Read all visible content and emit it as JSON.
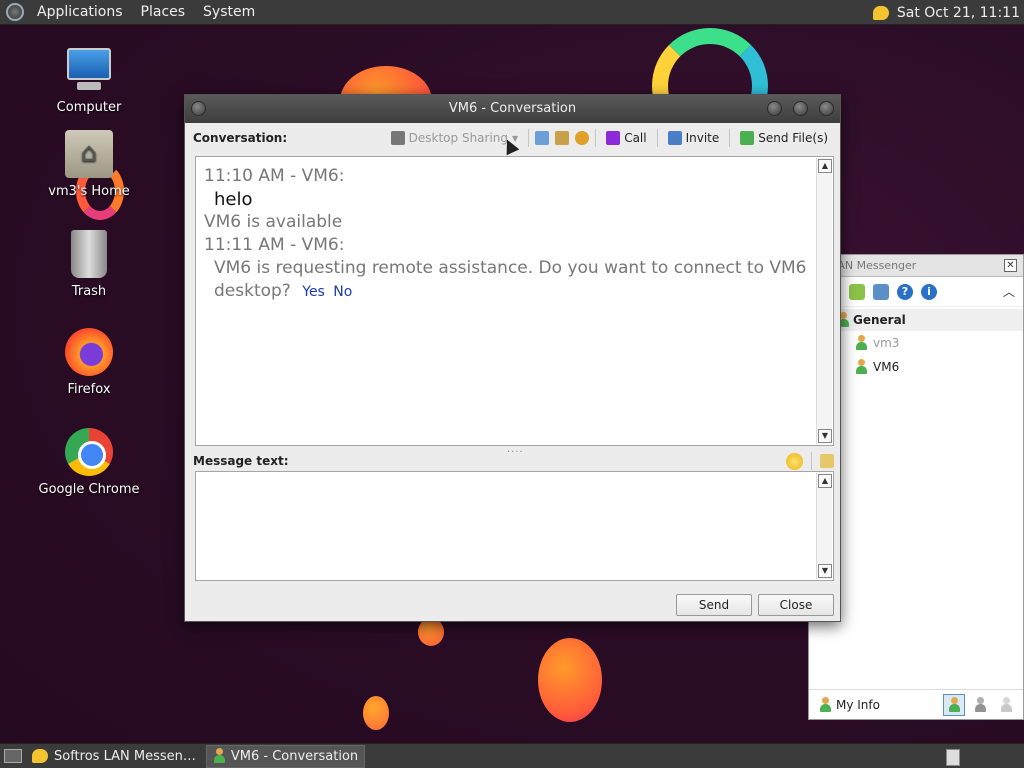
{
  "top_panel": {
    "menus": [
      "Applications",
      "Places",
      "System"
    ],
    "clock": "Sat Oct 21, 11:11"
  },
  "desktop_icons": [
    {
      "label": "Computer",
      "icon": "computer-icon"
    },
    {
      "label": "vm3's Home",
      "icon": "home-folder-icon"
    },
    {
      "label": "Trash",
      "icon": "trash-icon"
    },
    {
      "label": "Firefox",
      "icon": "firefox-icon"
    },
    {
      "label": "Google Chrome",
      "icon": "chrome-icon"
    }
  ],
  "conversation": {
    "title": "VM6 - Conversation",
    "toolbar_label": "Conversation:",
    "tools": {
      "desktop_sharing": "Desktop Sharing",
      "call": "Call",
      "invite": "Invite",
      "send_files": "Send File(s)"
    },
    "history": [
      {
        "type": "meta",
        "text": "11:10 AM - VM6:"
      },
      {
        "type": "msg",
        "text": "helo"
      },
      {
        "type": "meta",
        "text": "VM6 is available"
      },
      {
        "type": "meta",
        "text": "11:11 AM - VM6:"
      },
      {
        "type": "msg-grey",
        "text": "VM6 is requesting remote assistance. Do you want to connect to VM6 desktop?"
      }
    ],
    "history_links": {
      "yes": "Yes",
      "no": "No"
    },
    "message_label": "Message text:",
    "message_value": "",
    "send_label": "Send",
    "close_label": "Close"
  },
  "lan_messenger": {
    "title": "os LAN Messenger",
    "group": "General",
    "users": [
      {
        "name": "vm3",
        "status": "offline"
      },
      {
        "name": "VM6",
        "status": "online"
      }
    ],
    "my_info": "My Info"
  },
  "taskbar": {
    "items": [
      {
        "label": "Softros LAN Messen…",
        "active": false
      },
      {
        "label": "VM6 - Conversation",
        "active": true
      }
    ]
  }
}
